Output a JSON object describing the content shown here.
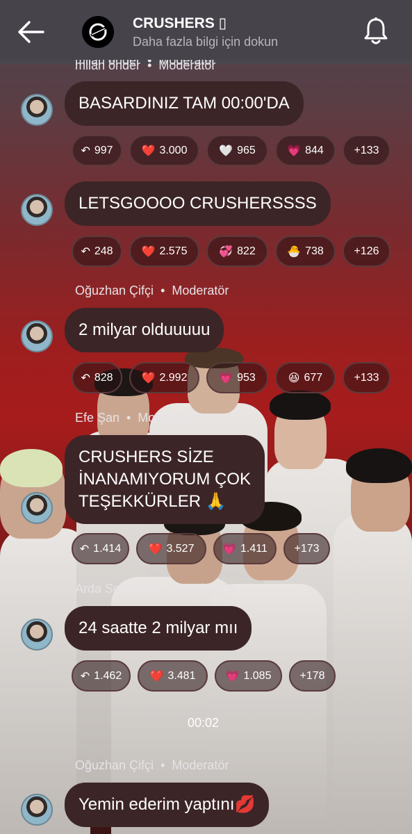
{
  "header": {
    "title": "CRUSHERS ▯",
    "subtitle": "Daha fazla bilgi için dokun"
  },
  "top_sender": "milan önder",
  "moderator_label": "Moderatör",
  "messages": [
    {
      "sender": "",
      "text": "BASARDINIZ TAM 00:00'DA",
      "reactions": [
        {
          "icon": "↶",
          "count": "997"
        },
        {
          "icon": "❤️",
          "count": "3.000"
        },
        {
          "icon": "🤍",
          "count": "965"
        },
        {
          "icon": "💗",
          "count": "844"
        },
        {
          "icon": "",
          "count": "+133"
        }
      ]
    },
    {
      "sender": "",
      "text": "LETSGOOOO CRUSHERSSSS",
      "reactions": [
        {
          "icon": "↶",
          "count": "248"
        },
        {
          "icon": "❤️",
          "count": "2.575"
        },
        {
          "icon": "💞",
          "count": "822"
        },
        {
          "icon": "🐣",
          "count": "738"
        },
        {
          "icon": "",
          "count": "+126"
        }
      ]
    },
    {
      "sender": "Oğuzhan Çifçi",
      "text": "2 milyar olduuuuu",
      "reactions": [
        {
          "icon": "↶",
          "count": "828"
        },
        {
          "icon": "❤️",
          "count": "2.992"
        },
        {
          "icon": "💗",
          "count": "953"
        },
        {
          "icon": "😆",
          "count": "677"
        },
        {
          "icon": "",
          "count": "+133"
        }
      ]
    },
    {
      "sender": "Efe Şan",
      "text_lines": [
        "CRUSHERS SİZE",
        "İNANAMIYORUM ÇOK",
        "TEŞEKKÜRLER 🙏"
      ],
      "reactions": [
        {
          "icon": "↶",
          "count": "1.414"
        },
        {
          "icon": "❤️",
          "count": "3.527"
        },
        {
          "icon": "💗",
          "count": "1.411"
        },
        {
          "icon": "",
          "count": "+173"
        }
      ]
    },
    {
      "sender": "Arda Soydoğan",
      "text": "24 saatte 2 milyar mıı",
      "reactions": [
        {
          "icon": "↶",
          "count": "1.462"
        },
        {
          "icon": "❤️",
          "count": "3.481"
        },
        {
          "icon": "💗",
          "count": "1.085"
        },
        {
          "icon": "",
          "count": "+178"
        }
      ]
    },
    {
      "sender": "Oğuzhan Çifçi",
      "text": "Yemin ederim yaptını💋",
      "reactions": []
    }
  ],
  "timestamp": "00:02",
  "colors": {
    "bubble": "#3c2527",
    "header": "#45424a",
    "accent_red": "#a71c1c"
  }
}
